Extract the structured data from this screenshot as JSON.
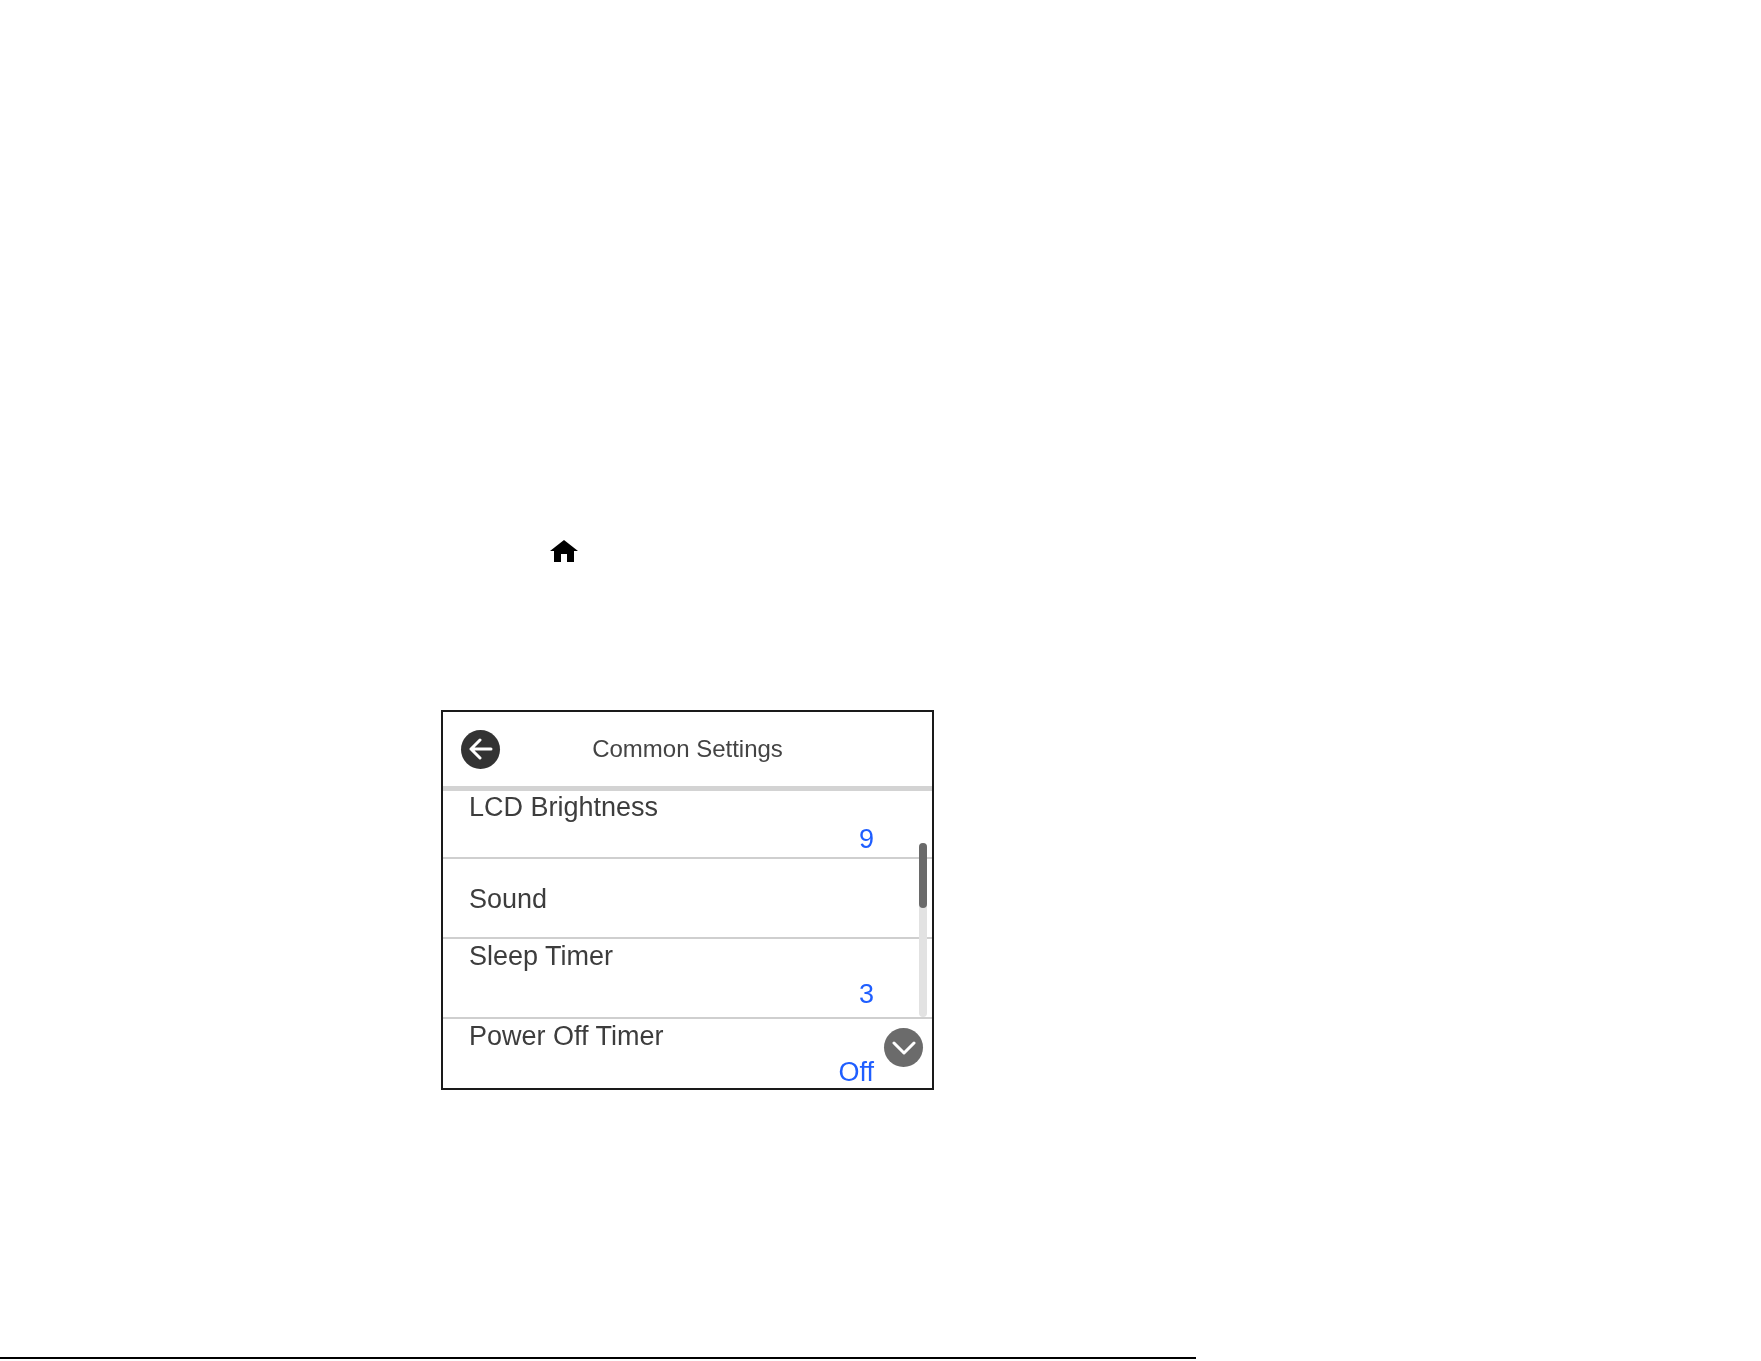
{
  "screen": {
    "title": "Common Settings"
  },
  "settings": [
    {
      "label": "LCD Brightness",
      "value": "9"
    },
    {
      "label": "Sound"
    },
    {
      "label": "Sleep Timer",
      "value": "3"
    },
    {
      "label": "Power Off Timer",
      "value": "Off"
    }
  ]
}
